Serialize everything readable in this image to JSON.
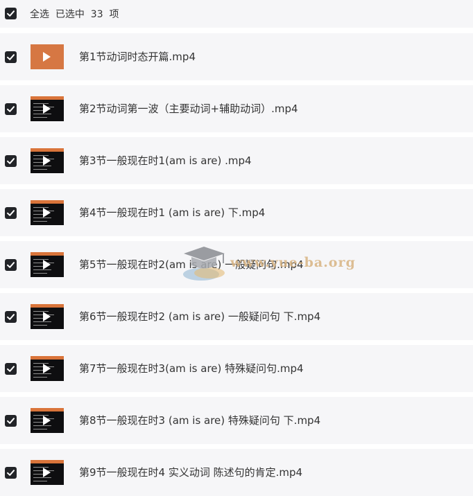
{
  "header": {
    "select_all": "全选",
    "selected_summary": "已选中  33  项"
  },
  "files": [
    {
      "name": "第1节动词时态开篇.mp4",
      "checked": true
    },
    {
      "name": "第2节动词第一波（主要动词+辅助动词）.mp4",
      "checked": true
    },
    {
      "name": "第3节一般现在时1(am is are) .mp4",
      "checked": true
    },
    {
      "name": "第4节一般现在时1 (am is are) 下.mp4",
      "checked": true
    },
    {
      "name": "第5节一般现在时2(am is are) 一般疑问句.mp4",
      "checked": true
    },
    {
      "name": "第6节一般现在时2 (am is are) 一般疑问句 下.mp4",
      "checked": true
    },
    {
      "name": "第7节一般现在时3(am is are) 特殊疑问句.mp4",
      "checked": true
    },
    {
      "name": "第8节一般现在时3 (am is are) 特殊疑问句 下.mp4",
      "checked": true
    },
    {
      "name": "第9节一般现在时4 实义动词 陈述句的肯定.mp4",
      "checked": true
    }
  ],
  "icons": {
    "checkbox": "checkmark-icon",
    "play": "play-icon",
    "watermark": "graduation-cap-icon"
  },
  "colors": {
    "checkbox_fill": "#222428",
    "row_background": "#f6f6f8",
    "thumbnail_accent": "#d9743a"
  },
  "watermark": {
    "text": "www.yue-ba.org"
  }
}
